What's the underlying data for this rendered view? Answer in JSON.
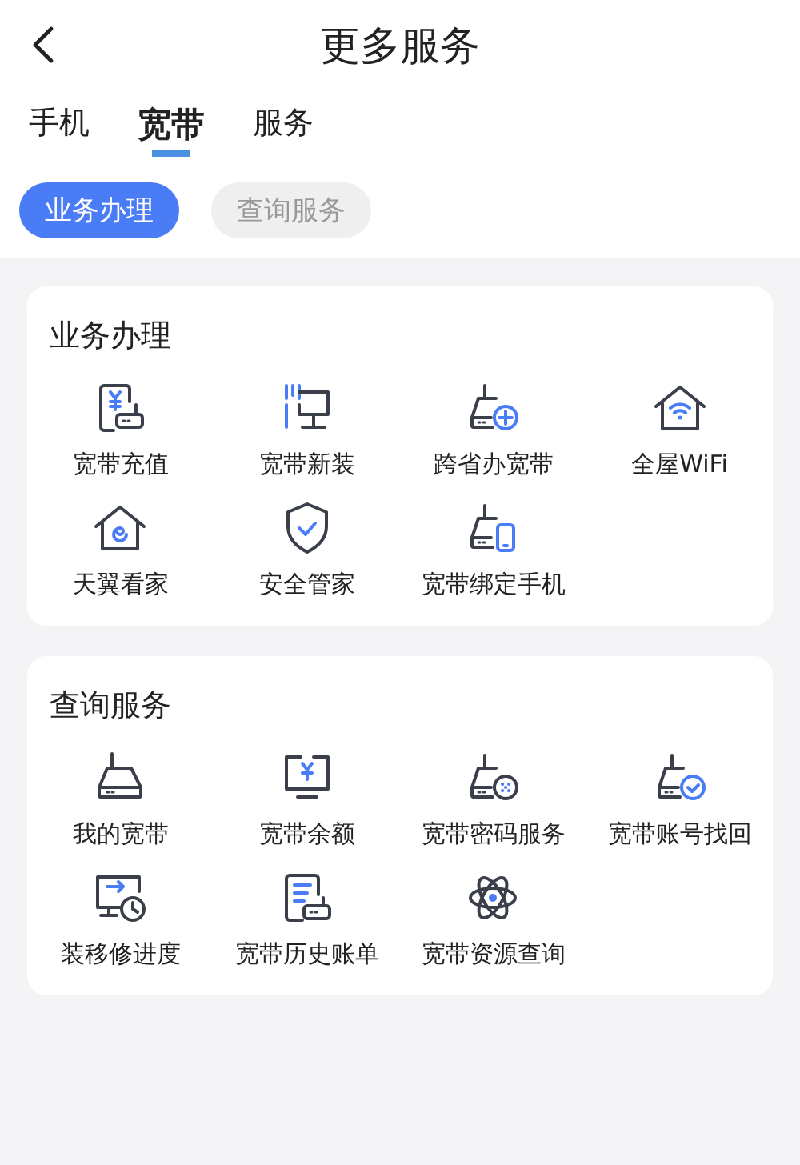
{
  "header": {
    "title": "更多服务"
  },
  "tabs": [
    {
      "label": "手机",
      "selected": false
    },
    {
      "label": "宽带",
      "selected": true
    },
    {
      "label": "服务",
      "selected": false
    }
  ],
  "chips": [
    {
      "label": "业务办理",
      "selected": true
    },
    {
      "label": "查询服务",
      "selected": false
    }
  ],
  "sections": [
    {
      "title": "业务办理",
      "items": [
        {
          "label": "宽带充值"
        },
        {
          "label": "宽带新装"
        },
        {
          "label": "跨省办宽带"
        },
        {
          "label": "全屋WiFi"
        },
        {
          "label": "天翼看家"
        },
        {
          "label": "安全管家"
        },
        {
          "label": "宽带绑定手机"
        }
      ]
    },
    {
      "title": "查询服务",
      "items": [
        {
          "label": "我的宽带"
        },
        {
          "label": "宽带余额"
        },
        {
          "label": "宽带密码服务"
        },
        {
          "label": "宽带账号找回"
        },
        {
          "label": "装移修进度"
        },
        {
          "label": "宽带历史账单"
        },
        {
          "label": "宽带资源查询"
        }
      ]
    }
  ]
}
